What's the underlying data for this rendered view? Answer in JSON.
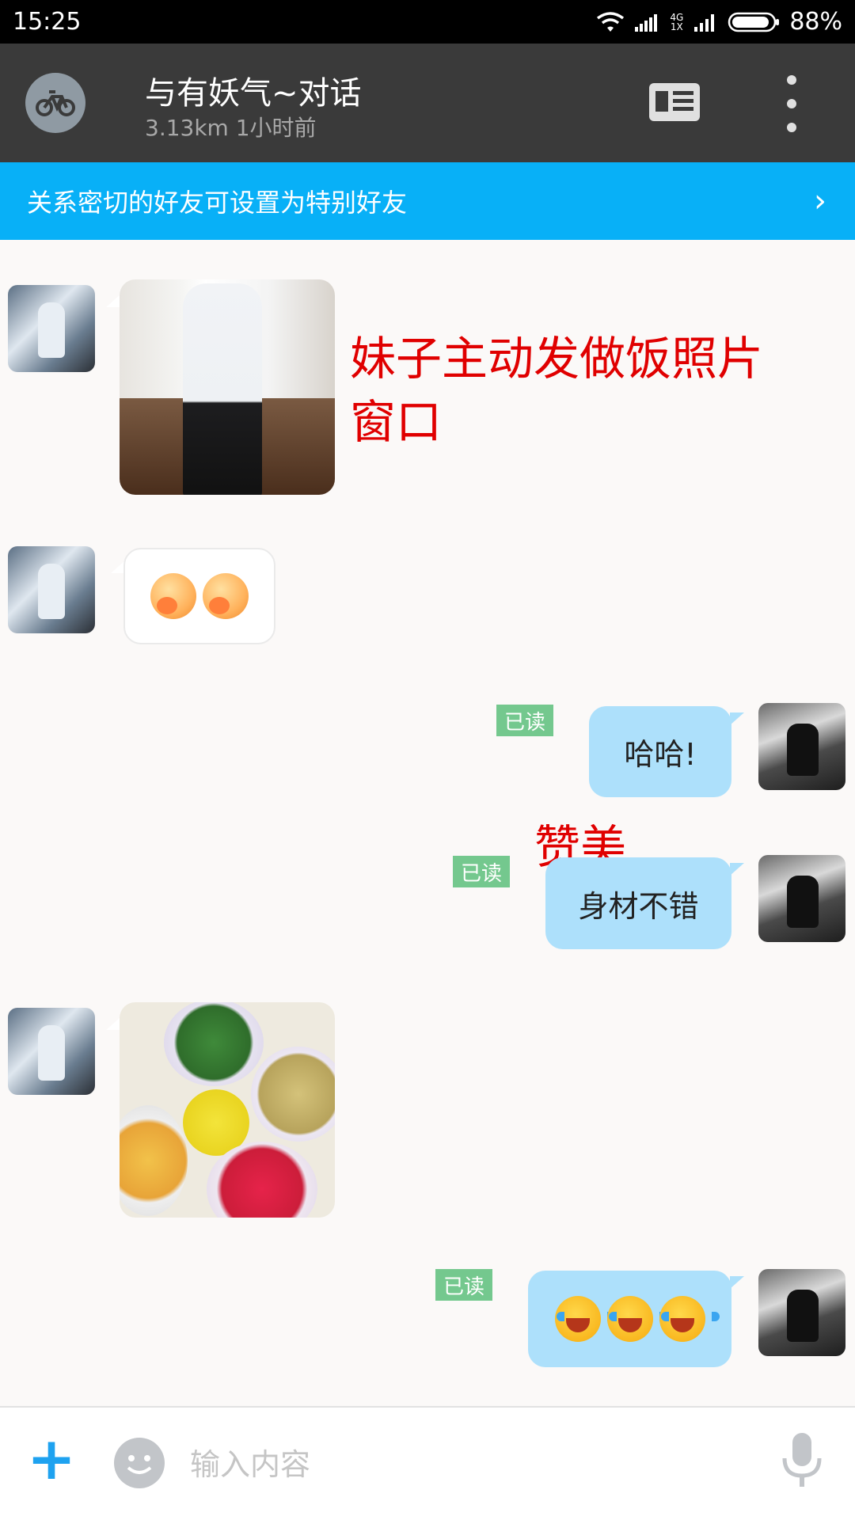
{
  "status_bar": {
    "time": "15:25",
    "network_top": "4G",
    "network_bottom": "1X",
    "battery": "88%",
    "icons": [
      "wifi-icon",
      "data-signal-icon",
      "cell-signal-icon",
      "battery-icon"
    ]
  },
  "header": {
    "title": "与有妖气~对话",
    "subtitle": "3.13km 1小时前",
    "icons": [
      "bike-icon",
      "profile-card-icon",
      "more-vert-icon"
    ]
  },
  "banner": {
    "text": "关系密切的好友可设置为特别好友",
    "arrow": "›"
  },
  "messages": [
    {
      "side": "left",
      "type": "image",
      "content": "kitchen-photo"
    },
    {
      "side": "left",
      "type": "emoji",
      "content": "blush-emoji ×2"
    },
    {
      "side": "right",
      "type": "text",
      "text": "哈哈!",
      "read": "已读"
    },
    {
      "side": "right",
      "type": "text",
      "text": "身材不错",
      "read": "已读"
    },
    {
      "side": "left",
      "type": "image",
      "content": "food-photo"
    },
    {
      "side": "right",
      "type": "emoji",
      "content": "laugh-emoji ×3",
      "read": "已读"
    }
  ],
  "annotations": {
    "photo_note_line1": "妹子主动发做饭照片",
    "photo_note_line2": "窗口",
    "praise_note": "赞美"
  },
  "input": {
    "placeholder": "输入内容",
    "icons": [
      "plus-icon",
      "emoji-icon",
      "mic-icon"
    ]
  },
  "colors": {
    "status_bar": "#000000",
    "title_bar": "#3a3a3a",
    "banner": "#08b0f7",
    "my_bubble": "#ade0fb",
    "read_badge": "#74c88e",
    "annotation": "#e00000",
    "accent_plus": "#1ea2f0"
  }
}
